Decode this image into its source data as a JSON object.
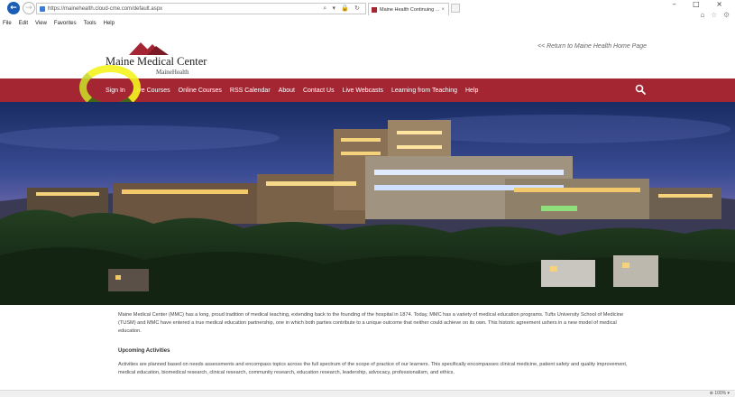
{
  "browser": {
    "url": "https://mainehealth.cloud-cme.com/default.aspx",
    "address_tools": "⌕ ▾ 🔒 ↻",
    "tab_title": "Maine Health Continuing ...",
    "tab_close": "×",
    "window_controls": "– □ ×",
    "right_icons": "⌂ ☆ ⚙",
    "menu": [
      "File",
      "Edit",
      "View",
      "Favorites",
      "Tools",
      "Help"
    ],
    "zoom": "⊕ 100%  ▾"
  },
  "header": {
    "logo_title": "Maine Medical Center",
    "logo_sub": "MaineHealth",
    "return_link": "<< Return to Maine Health Home Page"
  },
  "nav": {
    "items": [
      "Sign In",
      "Live Courses",
      "Online Courses",
      "RSS Calendar",
      "About",
      "Contact Us",
      "Live Webcasts",
      "Learning from Teaching",
      "Help"
    ]
  },
  "content": {
    "intro": "Maine Medical Center (MMC) has a long, proud tradition of medical teaching, extending back to the founding of the hospital in 1874. Today, MMC has a variety of medical education programs. Tufts University School of Medicine (TUSM) and MMC have entered a true medical education partnership, one in which both parties contribute to a unique outcome that neither could achieve on its own. This historic agreement ushers in a new model of medical education.",
    "upcoming_title": "Upcoming Activities",
    "upcoming_text": "Activities are planned based on needs assessments and encompass topics across the full spectrum of the scope of practice of our learners. This specifically encompasses clinical medicine, patient safety and quality improvement, medical education, biomedical research, clinical research, community research, education research, leadership, advocacy, professionalism, and ethics."
  },
  "colors": {
    "brand": "#a52633",
    "highlight": "#f5f51e"
  }
}
